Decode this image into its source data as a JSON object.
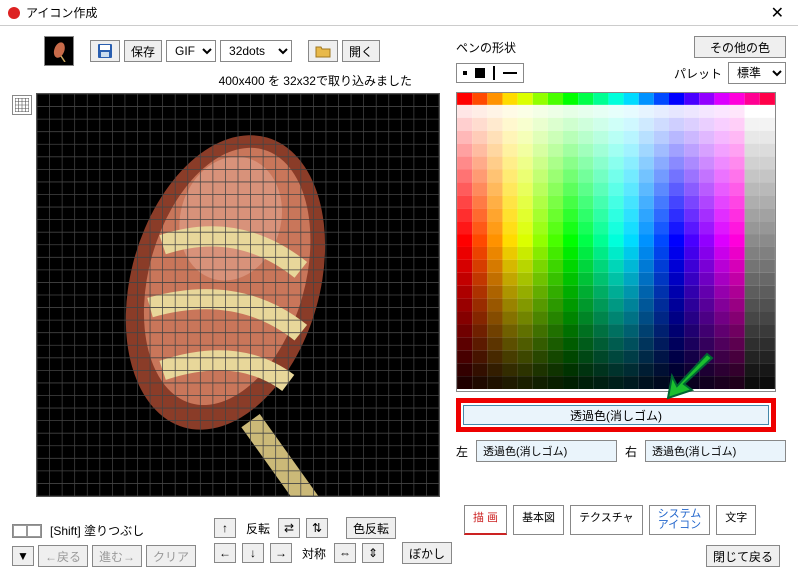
{
  "window": {
    "title": "アイコン作成",
    "close_glyph": "✕"
  },
  "toolbar": {
    "save_label": "保存",
    "format_options": [
      "GIF"
    ],
    "format_value": "GIF",
    "size_options": [
      "32dots"
    ],
    "size_value": "32dots",
    "open_label": "開く"
  },
  "status_text": "400x400 を 32x32で取り込みました",
  "footer": {
    "fill_hint": "[Shift] 塗りつぶし",
    "back_label": "←戻る",
    "forward_label": "進む→",
    "clear_label": "クリア",
    "flip_label": "反転",
    "sym_label": "対称",
    "invert_label": "色反転",
    "blur_label": "ぼかし"
  },
  "pen": {
    "shape_label": "ペンの形状",
    "other_color_label": "その他の色",
    "palette_label": "パレット",
    "palette_value": "標準"
  },
  "transparent": {
    "main_label": "透過色(消しゴム)",
    "left_lbl": "左",
    "left_val": "透過色(消しゴム)",
    "right_lbl": "右",
    "right_val": "透過色(消しゴム)"
  },
  "tabs": {
    "draw": "描 画",
    "basic": "基本図",
    "texture": "テクスチャ",
    "system": "システム\nアイコン",
    "text": "文字"
  },
  "close_return": "閉じて戻る"
}
